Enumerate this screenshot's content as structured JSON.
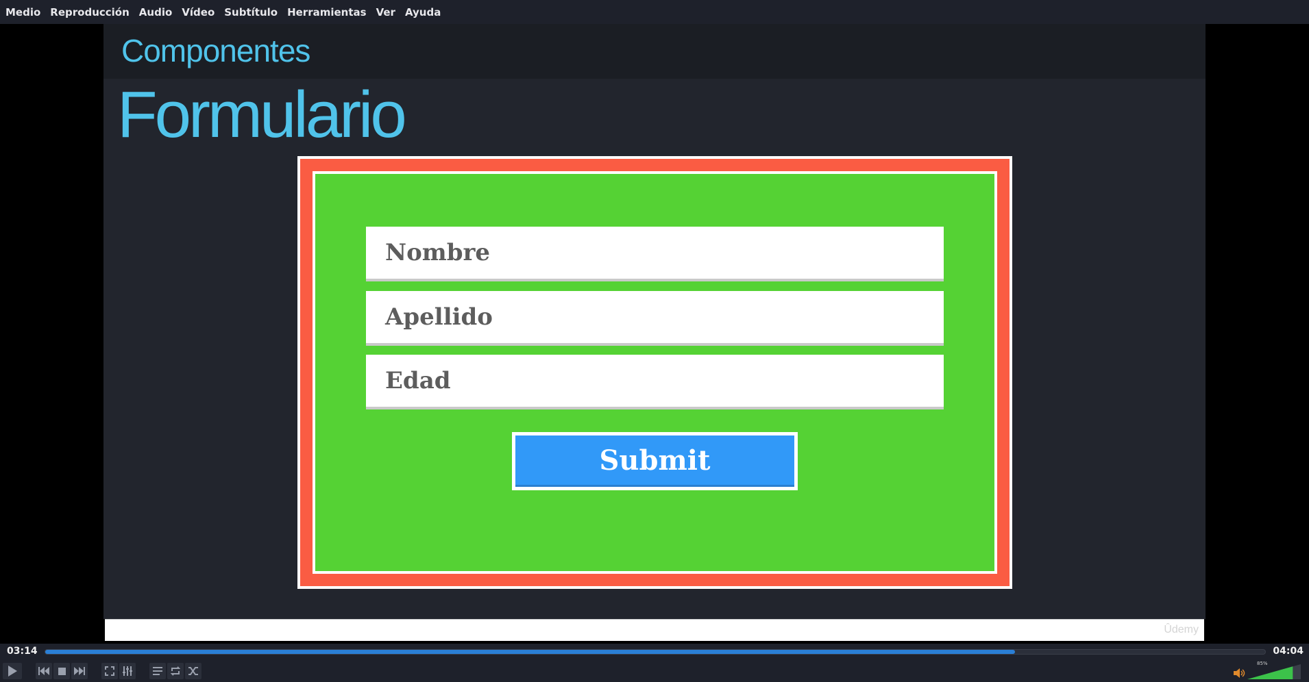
{
  "menubar": {
    "items": [
      "Medio",
      "Reproducción",
      "Audio",
      "Vídeo",
      "Subtítulo",
      "Herramientas",
      "Ver",
      "Ayuda"
    ]
  },
  "slide": {
    "subtitle": "Componentes",
    "title": "Formulario",
    "fields": [
      "Nombre",
      "Apellido",
      "Edad"
    ],
    "submit_label": "Submit",
    "watermark": "Ûdemy"
  },
  "player": {
    "current_time": "03:14",
    "total_time": "04:04",
    "progress": 0.795,
    "volume_label": "85%",
    "volume": 0.85,
    "buttons": [
      "play-icon",
      "previous-icon",
      "stop-icon",
      "next-icon",
      "fullscreen-icon",
      "extended-settings-icon",
      "playlist-icon",
      "loop-icon",
      "shuffle-icon"
    ]
  },
  "colors": {
    "accent": "#50c3ea",
    "frame_red": "#fa5c43",
    "form_green": "#55d234",
    "button_blue": "#3199f8",
    "progress_blue": "#2a7fd6"
  }
}
